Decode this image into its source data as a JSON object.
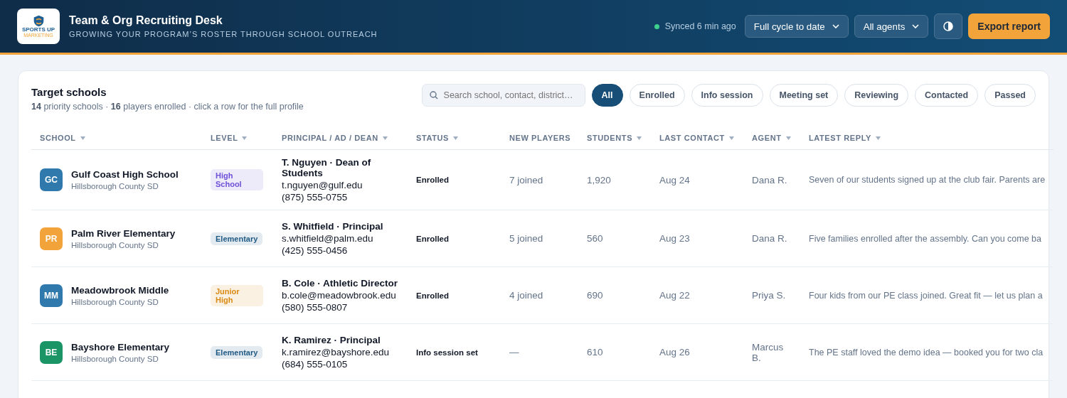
{
  "header": {
    "logo_text": "SPORTS UP",
    "logo_subtext": "MARKETING",
    "title": "Team & Org Recruiting Desk",
    "subtitle": "GROWING YOUR PROGRAM’S ROSTER THROUGH SCHOOL OUTREACH",
    "sync_status": "Synced 6 min ago",
    "dropdowns": [
      "Full cycle to date",
      "All agents"
    ],
    "export_button": "Export report"
  },
  "panel": {
    "title": "Target schools",
    "summary": "**14** priority schools · **16** players enrolled · click a row for the full profile",
    "search": {
      "placeholder": "Search school, contact, district…"
    },
    "filters": [
      {
        "label": "All",
        "selected": true
      },
      {
        "label": "Enrolled",
        "selected": false
      },
      {
        "label": "Info session",
        "selected": false
      },
      {
        "label": "Meeting set",
        "selected": false
      },
      {
        "label": "Reviewing",
        "selected": false
      },
      {
        "label": "Contacted",
        "selected": false
      },
      {
        "label": "Passed",
        "selected": false
      }
    ]
  },
  "table": {
    "columns": [
      {
        "label": "SCHOOL",
        "sortable": true
      },
      {
        "label": "LEVEL",
        "sortable": true
      },
      {
        "label": "PRINCIPAL / AD / DEAN",
        "sortable": true
      },
      {
        "label": "STATUS",
        "sortable": true
      },
      {
        "label": "NEW PLAYERS",
        "sortable": false
      },
      {
        "label": "STUDENTS",
        "sortable": true
      },
      {
        "label": "LAST CONTACT",
        "sortable": true
      },
      {
        "label": "AGENT",
        "sortable": true
      },
      {
        "label": "LATEST REPLY",
        "sortable": true
      }
    ],
    "rows": [
      {
        "initials": "GC",
        "color": "#2f79ad",
        "school": "Gulf Coast High School",
        "district": "Hillsborough County SD",
        "level": {
          "label": "High School",
          "color": "#6d4fd8"
        },
        "contact": "T. Nguyen · Dean of Students",
        "email": "t.nguyen@gulf.edu",
        "phone": "(875) 555-0755",
        "status": "Enrolled",
        "new_players": "7 joined",
        "students": "1,920",
        "last_contact": "Aug 24",
        "agent": "Dana R.",
        "reply": "Seven of our students signed up at the club fair. Parents are"
      },
      {
        "initials": "PR",
        "color": "#f2a33a",
        "school": "Palm River Elementary",
        "district": "Hillsborough County SD",
        "level": {
          "label": "Elementary",
          "color": "#1f5a85"
        },
        "contact": "S. Whitfield · Principal",
        "email": "s.whitfield@palm.edu",
        "phone": "(425) 555-0456",
        "status": "Enrolled",
        "new_players": "5 joined",
        "students": "560",
        "last_contact": "Aug 23",
        "agent": "Dana R.",
        "reply": "Five families enrolled after the assembly. Can you come ba"
      },
      {
        "initials": "MM",
        "color": "#2f79ad",
        "school": "Meadowbrook Middle",
        "district": "Hillsborough County SD",
        "level": {
          "label": "Junior High",
          "color": "#d98a12"
        },
        "contact": "B. Cole · Athletic Director",
        "email": "b.cole@meadowbrook.edu",
        "phone": "(580) 555-0807",
        "status": "Enrolled",
        "new_players": "4 joined",
        "students": "690",
        "last_contact": "Aug 22",
        "agent": "Priya S.",
        "reply": "Four kids from our PE class joined. Great fit — let us plan a"
      },
      {
        "initials": "BE",
        "color": "#1b9466",
        "school": "Bayshore Elementary",
        "district": "Hillsborough County SD",
        "level": {
          "label": "Elementary",
          "color": "#1f5a85"
        },
        "contact": "K. Ramirez · Principal",
        "email": "k.ramirez@bayshore.edu",
        "phone": "(684) 555-0105",
        "status": "Info session set",
        "new_players": "—",
        "students": "610",
        "last_contact": "Aug 26",
        "agent": "Marcus B.",
        "reply": "The PE staff loved the demo idea — booked you for two cla"
      }
    ]
  }
}
